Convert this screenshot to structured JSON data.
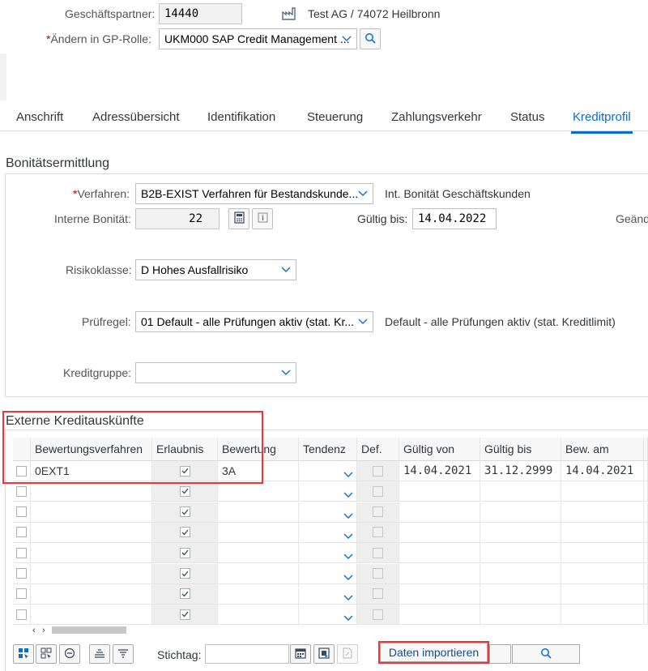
{
  "header": {
    "partner_label": "Geschäftspartner:",
    "partner_value": "14440",
    "partner_desc": "Test AG / 74072 Heilbronn",
    "role_label": "Ändern in GP-Rolle:",
    "role_value": "UKM000 SAP Credit Management ..."
  },
  "tabs": [
    {
      "label": "Anschrift"
    },
    {
      "label": "Adressübersicht"
    },
    {
      "label": "Identifikation"
    },
    {
      "label": "Steuerung"
    },
    {
      "label": "Zahlungsverkehr"
    },
    {
      "label": "Status"
    },
    {
      "label": "Kreditprofil"
    }
  ],
  "bonitaet": {
    "title": "Bonitätsermittlung",
    "verfahren_label": "Verfahren:",
    "verfahren_value": "B2B-EXIST Verfahren für Bestandskunde...",
    "verfahren_desc": "Int. Bonität Geschäftskunden",
    "intern_label": "Interne Bonität:",
    "intern_value": "22",
    "gueltig_label": "Gültig bis:",
    "gueltig_value": "14.04.2022",
    "geaend_label": "Geänd",
    "risiko_label": "Risikoklasse:",
    "risiko_value": "D Hohes Ausfallrisiko",
    "pruef_label": "Prüfregel:",
    "pruef_value": "01 Default - alle Prüfungen aktiv (stat. Kr...",
    "pruef_desc": "Default - alle Prüfungen aktiv (stat. Kreditlimit)",
    "gruppe_label": "Kreditgruppe:",
    "gruppe_value": ""
  },
  "extern": {
    "title": "Externe Kreditauskünfte",
    "columns": [
      "Bewertungsverfahren",
      "Erlaubnis",
      "Bewertung",
      "Tendenz",
      "Def.",
      "Gültig von",
      "Gültig bis",
      "Bew. am"
    ],
    "rows": [
      {
        "verfahren": "0EXT1",
        "bewertung": "3A",
        "von": "14.04.2021",
        "bis": "31.12.2999",
        "am": "14.04.2021"
      }
    ],
    "empty_rows": 7
  },
  "toolbar": {
    "stichtag_label": "Stichtag:",
    "stichtag_value": "",
    "import_label": "Daten importieren"
  },
  "colors": {
    "accent": "#0a6ed1",
    "highlight": "#e8383d",
    "required": "#bb0000"
  }
}
